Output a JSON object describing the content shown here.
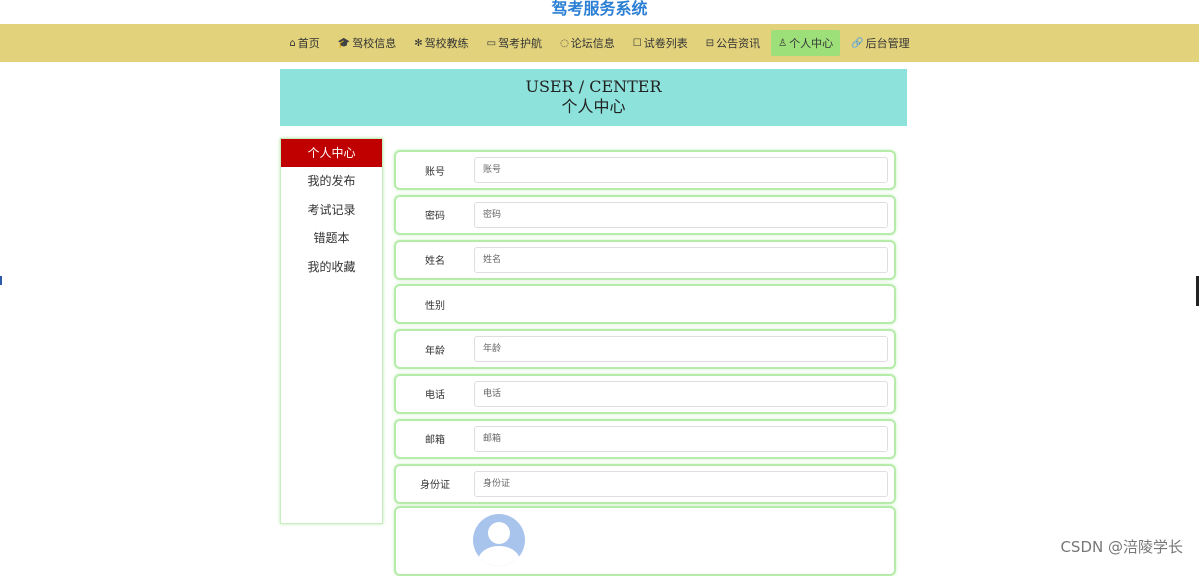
{
  "site": {
    "title": "驾考服务系统"
  },
  "nav": {
    "items": [
      {
        "icon": "⌂",
        "label": "首页"
      },
      {
        "icon": "🎓",
        "label": "驾校信息"
      },
      {
        "icon": "✻",
        "label": "驾校教练"
      },
      {
        "icon": "▭",
        "label": "驾考护航"
      },
      {
        "icon": "◌",
        "label": "论坛信息"
      },
      {
        "icon": "☐",
        "label": "试卷列表"
      },
      {
        "icon": "⊟",
        "label": "公告资讯"
      },
      {
        "icon": "♙",
        "label": "个人中心"
      },
      {
        "icon": "🔗",
        "label": "后台管理"
      }
    ],
    "active_color": "#9de07a"
  },
  "banner": {
    "en": "USER / CENTER",
    "cn": "个人中心"
  },
  "sidebar": {
    "items": [
      "个人中心",
      "我的发布",
      "考试记录",
      "错题本",
      "我的收藏"
    ],
    "active_color": "#c00000"
  },
  "form": {
    "fields": [
      {
        "label": "账号",
        "placeholder": "账号"
      },
      {
        "label": "密码",
        "placeholder": "密码"
      },
      {
        "label": "姓名",
        "placeholder": "姓名"
      },
      {
        "label": "性别"
      },
      {
        "label": "年龄",
        "placeholder": "年龄"
      },
      {
        "label": "电话",
        "placeholder": "电话"
      },
      {
        "label": "邮箱",
        "placeholder": "邮箱"
      },
      {
        "label": "身份证",
        "placeholder": "身份证"
      }
    ]
  },
  "watermark": "CSDN @涪陵学长",
  "colors": {
    "nav_bg": "#e2d27c",
    "banner_bg": "#8de2dc",
    "title": "#2a7fd4",
    "field_border": "#b5ecaa"
  }
}
